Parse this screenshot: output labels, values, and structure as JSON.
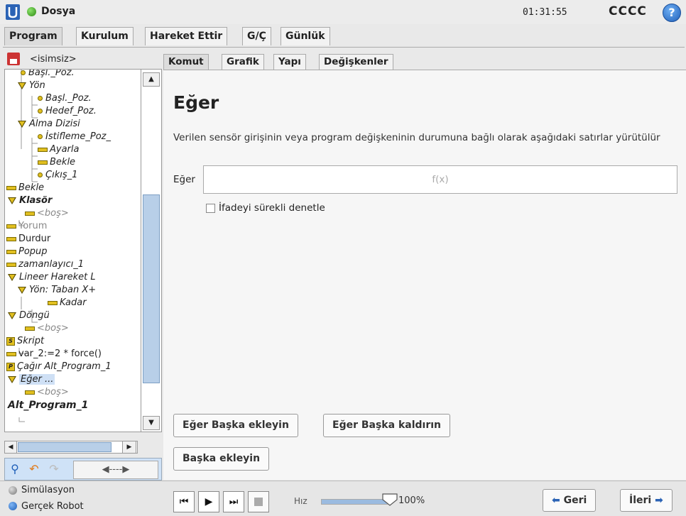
{
  "header": {
    "file_label": "Dosya",
    "time": "01:31:55",
    "robot_name": "CCCC",
    "help": "?"
  },
  "main_tabs": [
    "Program",
    "Kurulum",
    "Hareket Ettir",
    "G/Ç",
    "Günlük"
  ],
  "program": {
    "name": "<isimsiz>",
    "tree": [
      {
        "label": "Başl._Poz.",
        "style": "italic",
        "icon": "dot"
      },
      {
        "label": "Yön",
        "style": "italic",
        "icon": "triangle"
      },
      {
        "label": "Başl._Poz.",
        "style": "italic",
        "icon": "dot"
      },
      {
        "label": "Hedef_Poz.",
        "style": "italic",
        "icon": "dot"
      },
      {
        "label": "Alma Dizisi",
        "style": "italic",
        "icon": "triangle"
      },
      {
        "label": "İstifleme_Poz_",
        "style": "italic",
        "icon": "dot"
      },
      {
        "label": "Ayarla",
        "style": "italic",
        "icon": "bar"
      },
      {
        "label": "Bekle",
        "style": "italic",
        "icon": "bar"
      },
      {
        "label": "Çıkış_1",
        "style": "italic",
        "icon": "dot"
      },
      {
        "label": "Bekle",
        "style": "italic",
        "icon": "bar"
      },
      {
        "label": "Klasör",
        "style": "bold-italic",
        "icon": "triangle"
      },
      {
        "label": "<boş>",
        "style": "italic-gray",
        "icon": "bar"
      },
      {
        "label": "Yorum",
        "style": "gray",
        "icon": "bar"
      },
      {
        "label": "Durdur",
        "style": "normal",
        "icon": "bar"
      },
      {
        "label": "Popup",
        "style": "italic",
        "icon": "bar"
      },
      {
        "label": "zamanlayıcı_1",
        "style": "italic",
        "icon": "bar"
      },
      {
        "label": "Lineer Hareket L",
        "style": "italic",
        "icon": "triangle"
      },
      {
        "label": "Yön: Taban X+",
        "style": "italic",
        "icon": "triangle"
      },
      {
        "label": "Kadar",
        "style": "italic",
        "icon": "bar"
      },
      {
        "label": "Döngü",
        "style": "italic",
        "icon": "triangle"
      },
      {
        "label": "<boş>",
        "style": "italic-gray",
        "icon": "bar"
      },
      {
        "label": "Skript",
        "style": "italic",
        "icon": "script"
      },
      {
        "label": "var_2:=2 * force()",
        "style": "normal",
        "icon": "bar"
      },
      {
        "label": "Çağır Alt_Program_1",
        "style": "italic",
        "icon": "call"
      },
      {
        "label": "Eğer ...",
        "style": "italic-selected",
        "icon": "triangle"
      },
      {
        "label": "<boş>",
        "style": "italic-gray",
        "icon": "bar"
      },
      {
        "label": "Alt_Program_1",
        "style": "bold-italic",
        "icon": "none"
      }
    ]
  },
  "sub_tabs": [
    "Komut",
    "Grafik",
    "Yapı",
    "Değişkenler"
  ],
  "command": {
    "title": "Eğer",
    "description": "Verilen sensör girişinin veya program değişkeninin durumuna bağlı olarak aşağıdaki satırlar yürütülür",
    "condition_label": "Eğer",
    "condition_placeholder": "f(x)",
    "continuous_check_label": "İfadeyi sürekli denetle",
    "continuous_check": false,
    "add_else_if_label": "Eğer Başka ekleyin",
    "remove_else_if_label": "Eğer Başka kaldırın",
    "add_else_label": "Başka ekleyin"
  },
  "footer": {
    "mode_simulation": "Simülasyon",
    "mode_real": "Gerçek Robot",
    "speed_label": "Hız",
    "speed_value": "100%",
    "speed_fraction": 1.0,
    "back_label": "Geri",
    "next_label": "İleri"
  },
  "colors": {
    "accent_blue": "#1f5fb8",
    "node_yellow": "#e2c020",
    "status_green": "#2f8a14"
  }
}
